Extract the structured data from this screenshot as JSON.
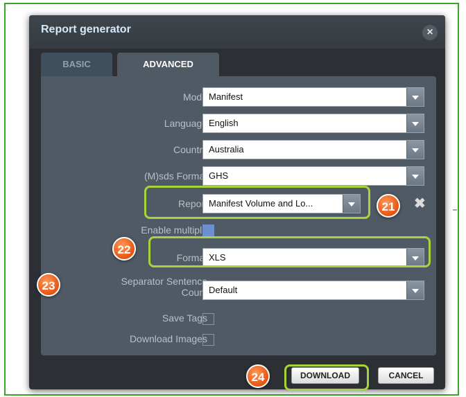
{
  "dialog": {
    "title": "Report generator",
    "close_glyph": "×"
  },
  "tabs": [
    {
      "label": "BASIC",
      "active": false
    },
    {
      "label": "ADVANCED",
      "active": true
    }
  ],
  "form": {
    "mode": {
      "label": "Mode",
      "value": "Manifest"
    },
    "language": {
      "label": "Language",
      "value": "English"
    },
    "country": {
      "label": "Country",
      "value": "Australia"
    },
    "msds_format": {
      "label": "(M)sds Format",
      "value": "GHS"
    },
    "report": {
      "label": "Report",
      "value": "Manifest Volume and Lo..."
    },
    "remove_glyph": "✖",
    "enable_multiple": {
      "label": "Enable multiple",
      "checked": true
    },
    "format": {
      "label": "Format",
      "value": "XLS"
    },
    "separator": {
      "label_line1": "Separator Sentence",
      "label_line2": "Count",
      "value": "Default"
    },
    "save_tags": {
      "label": "Save Tags",
      "checked": false
    },
    "download_images": {
      "label": "Download Images",
      "checked": false
    }
  },
  "buttons": {
    "download": "DOWNLOAD",
    "cancel": "CANCEL"
  },
  "annotations": {
    "b21": "21",
    "b22": "22",
    "b23": "23",
    "b24": "24"
  },
  "colors": {
    "highlight": "#a8d33a",
    "badge": "#e55412",
    "frame": "#3aa329",
    "dialog_bg": "#2c3034",
    "panel_bg": "#4f5a64"
  }
}
